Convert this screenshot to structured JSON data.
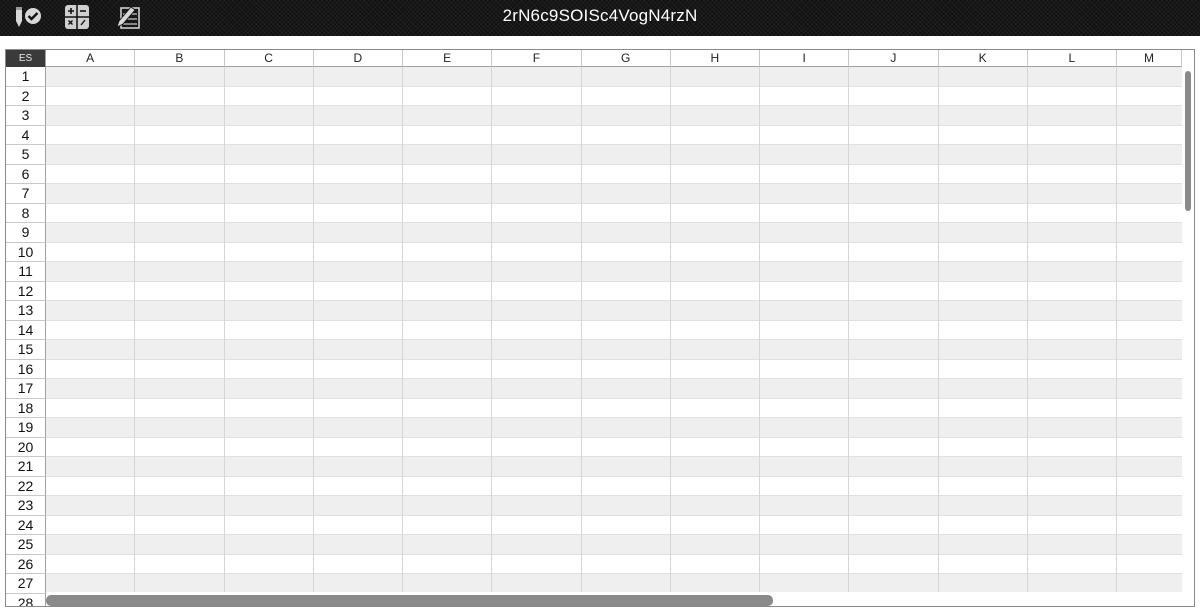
{
  "app": {
    "title": "2rN6c9SOISc4VogN4rzN"
  },
  "toolbar": {
    "icons": [
      {
        "name": "validate-icon"
      },
      {
        "name": "calculator-icon"
      },
      {
        "name": "edit-icon"
      }
    ]
  },
  "sheet": {
    "corner_label": "ES",
    "columns": [
      "A",
      "B",
      "C",
      "D",
      "E",
      "F",
      "G",
      "H",
      "I",
      "J",
      "K",
      "L",
      "M"
    ],
    "rows": [
      "1",
      "2",
      "3",
      "4",
      "5",
      "6",
      "7",
      "8",
      "9",
      "10",
      "11",
      "12",
      "13",
      "14",
      "15",
      "16",
      "17",
      "18",
      "19",
      "20",
      "21",
      "22",
      "23",
      "24",
      "25",
      "26",
      "27",
      "28"
    ]
  }
}
